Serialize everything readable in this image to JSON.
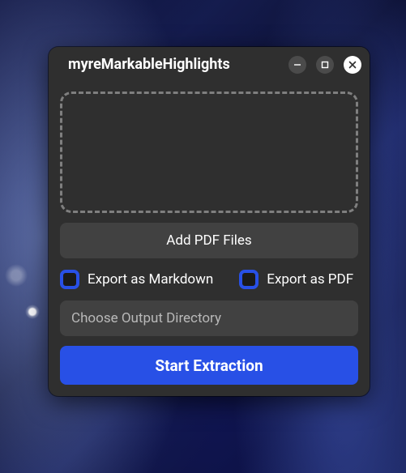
{
  "window": {
    "title": "myreMarkableHighlights"
  },
  "dropzone": {},
  "buttons": {
    "add_pdf": "Add PDF Files",
    "start": "Start Extraction"
  },
  "checks": {
    "markdown": "Export as Markdown",
    "pdf": "Export as PDF"
  },
  "output": {
    "placeholder": "Choose Output Directory",
    "value": ""
  },
  "colors": {
    "accent": "#2850e6",
    "window_bg": "#2f2f2f",
    "button_bg": "#414141"
  }
}
